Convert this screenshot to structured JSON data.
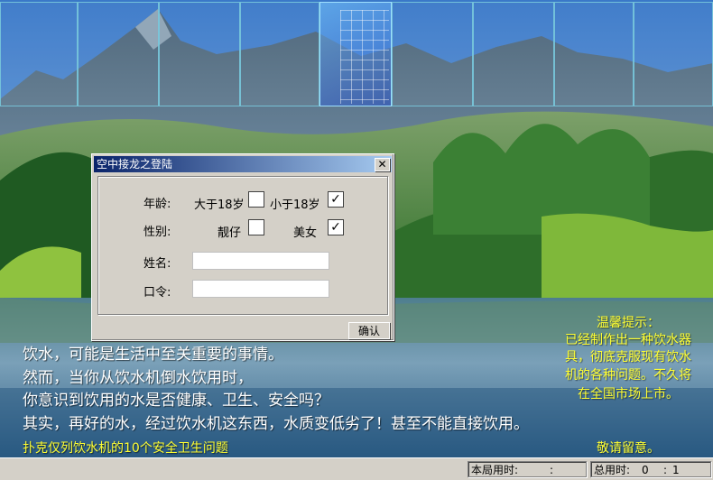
{
  "window": {
    "title": "空中接龙之登陆"
  },
  "dialog": {
    "age_label": "年龄:",
    "age_over": "大于18岁",
    "age_under": "小于18岁",
    "gender_label": "性别:",
    "gender_male": "靓仔",
    "gender_female": "美女",
    "name_label": "姓名:",
    "name_value": "",
    "password_label": "口令:",
    "password_value": "",
    "confirm_button": "确认",
    "close_glyph": "✕",
    "check_glyph": "✓",
    "age_over_checked": false,
    "age_under_checked": true,
    "male_checked": false,
    "female_checked": true
  },
  "story": [
    "饮水，可能是生活中至关重要的事情。",
    "然而，当你从饮水机倒水饮用时，",
    "你意识到饮用的水是否健康、卫生、安全吗？",
    "其实，再好的水，经过饮水机这东西，水质变低劣了！甚至不能直接饮用。"
  ],
  "story_footer": "扑克仅列饮水机的10个安全卫生问题",
  "tip": {
    "title": "温馨提示：",
    "lines": [
      "已经制作出一种饮水器",
      "具，彻底克服现有饮水",
      "机的各种问题。不久将",
      "在全国市场上市。"
    ],
    "footer": "敬请留意。"
  },
  "status": {
    "round_label": "本局用时:",
    "round_value": ":",
    "total_label": "总用时:",
    "total_minutes": "0",
    "total_sep": ":",
    "total_seconds": "1"
  },
  "icons": {
    "card_slots": "card-slot",
    "selected": "selected-card-slot"
  },
  "colors": {
    "titlebar": "#0a246a",
    "dialog": "#d4d0c8",
    "highlight_text": "#ffff33"
  }
}
